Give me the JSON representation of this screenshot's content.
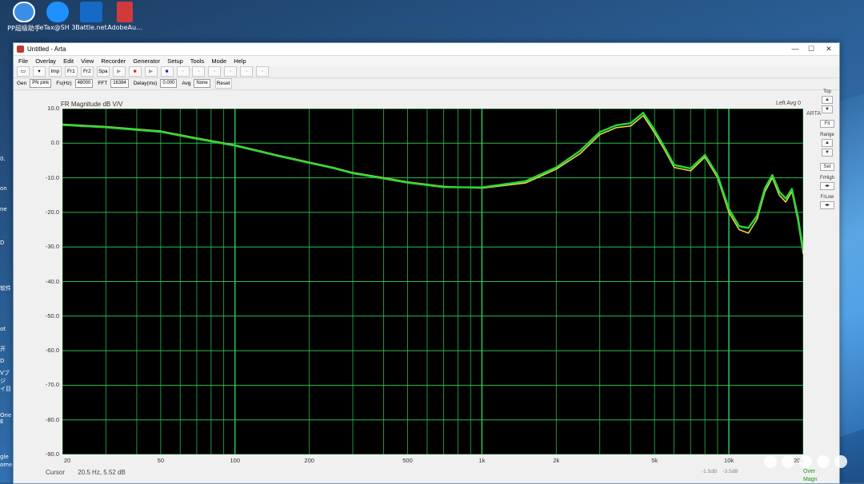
{
  "desktop": {
    "icons": [
      "PP超级助手",
      "eTax@SH 3",
      "Battle.net",
      "AdobeAu..."
    ],
    "left_edge": [
      "0.",
      "on",
      "ne",
      "D",
      "软件",
      "ot",
      "开",
      "D",
      "Vブ",
      "ジ",
      "イ目",
      "One",
      "E",
      "gle",
      "ome"
    ]
  },
  "window": {
    "title": "Untitled - Arta",
    "controls": [
      "—",
      "☐",
      "✕"
    ]
  },
  "menu": [
    "File",
    "Overlay",
    "Edit",
    "View",
    "Recorder",
    "Generator",
    "Setup",
    "Tools",
    "Mode",
    "Help"
  ],
  "toolbar1": {
    "buttons": [
      "Imp",
      "Fr1",
      "Fr2",
      "Spa"
    ]
  },
  "toolbar2": {
    "gen_label": "Gen",
    "gen_value": "PN pink",
    "fs_label": "Fs(Hz)",
    "fs_value": "48000",
    "fft_label": "FFT",
    "fft_value": "16384",
    "delay_label": "Delay(ms)",
    "delay_value": "0.000",
    "avg_label": "Avg",
    "avg_value": "None",
    "reset_label": "Reset"
  },
  "plot": {
    "title": "FR Magnitude dB V/V",
    "right_info": "Left  Avg 0",
    "side_text": "ARTA",
    "legend": [
      "Over",
      "Magn"
    ]
  },
  "side_panel": {
    "top_label": "Top",
    "fit_label": "Fit",
    "range_label": "Range",
    "set_label": "Set",
    "frhigh_label": "FrHigh",
    "frlow_label": "FrLow"
  },
  "status": {
    "cursor_label": "Cursor",
    "cursor_value": "20.5 Hz, 5.52 dB",
    "right_a": "-1.5dB",
    "right_b": "-3.5dB"
  },
  "colors": {
    "plot_bg": "#000000",
    "grid": "#2ee05a",
    "overlay_trace": "#e6d640",
    "magnitude_trace": "#28d83a"
  },
  "chart_data": {
    "type": "line",
    "title": "FR Magnitude dB V/V",
    "xlabel": "",
    "ylabel": "",
    "x_scale": "log",
    "xlim": [
      20,
      20000
    ],
    "ylim": [
      -90,
      10
    ],
    "x_ticks": [
      "20",
      "50",
      "100",
      "200",
      "500",
      "1k",
      "2k",
      "5k",
      "10k",
      "20k"
    ],
    "x_tick_values": [
      20,
      50,
      100,
      200,
      500,
      1000,
      2000,
      5000,
      10000,
      20000
    ],
    "y_ticks": [
      "10.0",
      "0.0",
      "-10.0",
      "-20.0",
      "-30.0",
      "-40.0",
      "-50.0",
      "-60.0",
      "-70.0",
      "-80.0",
      "-90.0"
    ],
    "y_tick_values": [
      10,
      0,
      -10,
      -20,
      -30,
      -40,
      -50,
      -60,
      -70,
      -80,
      -90
    ],
    "grid": true,
    "legend": "bottom-right",
    "series": [
      {
        "name": "Over",
        "x": [
          20,
          30,
          50,
          70,
          100,
          150,
          200,
          250,
          300,
          400,
          500,
          700,
          1000,
          1500,
          2000,
          2500,
          3000,
          3500,
          4000,
          4500,
          5000,
          5500,
          6000,
          7000,
          8000,
          9000,
          10000,
          11000,
          12000,
          13000,
          14000,
          15000,
          16000,
          17000,
          18000,
          19000,
          20000
        ],
        "y": [
          5.5,
          4.8,
          3.5,
          1.5,
          -0.5,
          -3.5,
          -5.5,
          -7.0,
          -8.5,
          -10.0,
          -11.2,
          -12.5,
          -13.0,
          -11.5,
          -7.5,
          -3.0,
          2.5,
          4.5,
          5.0,
          8.0,
          3.0,
          -2.0,
          -7.0,
          -8.0,
          -4.0,
          -10.0,
          -20.0,
          -25.0,
          -26.0,
          -22.0,
          -14.0,
          -10.0,
          -15.0,
          -17.0,
          -14.0,
          -22.0,
          -32.0
        ]
      },
      {
        "name": "Magn",
        "x": [
          20,
          30,
          50,
          70,
          100,
          150,
          200,
          250,
          300,
          400,
          500,
          700,
          1000,
          1500,
          2000,
          2500,
          3000,
          3500,
          4000,
          4500,
          5000,
          5500,
          6000,
          7000,
          8000,
          9000,
          10000,
          11000,
          12000,
          13000,
          14000,
          15000,
          16000,
          17000,
          18000,
          19000,
          20000
        ],
        "y": [
          5.3,
          4.6,
          3.3,
          1.3,
          -0.7,
          -3.7,
          -5.7,
          -7.2,
          -8.7,
          -10.2,
          -11.4,
          -12.7,
          -12.8,
          -11.0,
          -7.0,
          -2.2,
          3.2,
          5.2,
          5.8,
          8.8,
          3.8,
          -1.3,
          -6.3,
          -7.3,
          -3.4,
          -9.3,
          -19.0,
          -24.0,
          -24.5,
          -21.0,
          -13.0,
          -9.2,
          -14.0,
          -16.0,
          -13.2,
          -21.0,
          -31.0
        ]
      }
    ]
  }
}
